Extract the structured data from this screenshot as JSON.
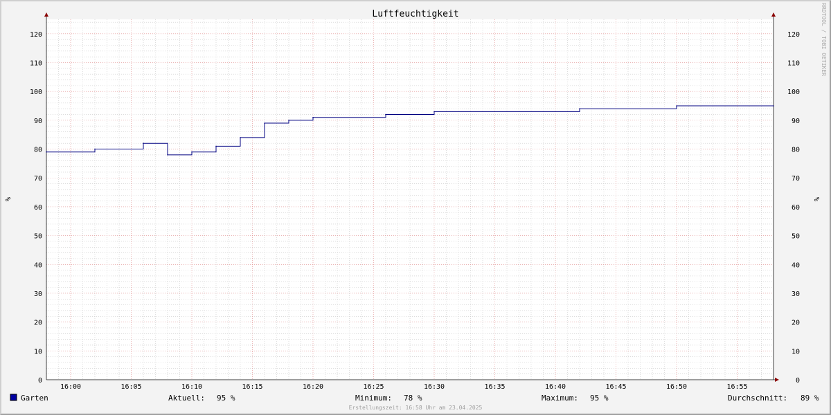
{
  "chart_data": {
    "type": "line",
    "title": "Luftfeuchtigkeit",
    "ylabel": "%",
    "ylabel_right": "%",
    "watermark": "RRDTOOL / TOBI OETIKER",
    "ylim": [
      0,
      125
    ],
    "yticks": [
      0,
      10,
      20,
      30,
      40,
      50,
      60,
      70,
      80,
      90,
      100,
      110,
      120
    ],
    "xlim": [
      "15:58",
      "16:58"
    ],
    "xticks": [
      "16:00",
      "16:05",
      "16:10",
      "16:15",
      "16:20",
      "16:25",
      "16:30",
      "16:35",
      "16:40",
      "16:45",
      "16:50",
      "16:55"
    ],
    "grid": true,
    "series": [
      {
        "name": "Garten",
        "color": "#000080",
        "step": true,
        "points": [
          [
            "15:58",
            79
          ],
          [
            "16:02",
            80
          ],
          [
            "16:06",
            82
          ],
          [
            "16:08",
            78
          ],
          [
            "16:10",
            79
          ],
          [
            "16:12",
            81
          ],
          [
            "16:14",
            84
          ],
          [
            "16:16",
            89
          ],
          [
            "16:18",
            90
          ],
          [
            "16:20",
            91
          ],
          [
            "16:26",
            92
          ],
          [
            "16:30",
            93
          ],
          [
            "16:42",
            94
          ],
          [
            "16:50",
            95
          ],
          [
            "16:58",
            95
          ]
        ]
      }
    ],
    "legend": {
      "swatch_color": "#0000a0",
      "name": "Garten",
      "stats": [
        {
          "label": "Aktuell:",
          "value": "95 %"
        },
        {
          "label": "Minimum:",
          "value": "78 %"
        },
        {
          "label": "Maximum:",
          "value": "95 %"
        },
        {
          "label": "Durchschnitt:",
          "value": "89 %"
        }
      ]
    },
    "footer": "Erstellungszeit: 16:58 Uhr am 23.04.2025"
  }
}
